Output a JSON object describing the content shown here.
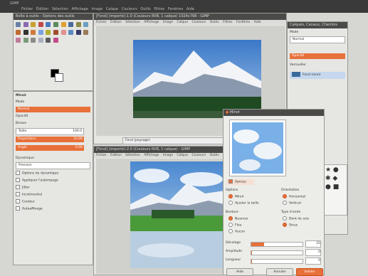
{
  "topbar": {
    "title": "GIMP",
    "menu": "Fichier Édition Sélection Affichage Image Calque Couleurs Outils Filtres Fenêtres Aide"
  },
  "toolbox": {
    "title": "Boîte à outils - Options des outils"
  },
  "options": {
    "title": "Miroir",
    "rows": [
      "Mode",
      "Normal",
      "Opacité",
      "Brosse",
      "Taille",
      "Proportions",
      "Angle",
      "Dynamique",
      "Pression"
    ],
    "values": [
      "100.0",
      "10.00",
      "0.00",
      "0.00"
    ],
    "checks": [
      "Options de dynamique",
      "Appliquer l'estompage",
      "Jitter",
      "Incrémentiel",
      "Contour",
      "Autoaffinage"
    ]
  },
  "img1": {
    "title": "[Fond] (importé)-1.0 (Couleurs RVB, 1 calque) 1024x768 - GIMP",
    "menu": "Fichier Édition Sélection Affichage Image Calque Couleurs Outils Filtres Fenêtres Aide",
    "status": "Fond (paysage)"
  },
  "img2": {
    "title": "[Fond] (importé)-2.0 (Couleurs RVB, 1 calque) - GIMP",
    "menu": "Fichier Édition Sélection Affichage Image Calque Couleurs Outils Filtres Fenêtres Aide"
  },
  "layers": {
    "title": "Calques, Canaux, Chemins",
    "mode": "Mode",
    "mode_val": "Normal",
    "opacity": "Opacité",
    "lock": "Verrouiller",
    "layer_name": "Fond miroir"
  },
  "dialog": {
    "title": "Miroir",
    "preview_label": "Aperçu",
    "options_title": "Options",
    "options": [
      "Miroir",
      "Ajuster la taille"
    ],
    "orientation_title": "Orientation",
    "orientation": [
      "Horizontal",
      "Vertical"
    ],
    "border_title": "Bordure",
    "border": [
      "Nuancer",
      "Flou",
      "Aucun"
    ],
    "wave_title": "Type d'onde",
    "wave": [
      "Dent de scie",
      "Sinus"
    ],
    "sliders": [
      {
        "label": "Décalage",
        "value": "25"
      },
      {
        "label": "Amplitude",
        "value": "0"
      },
      {
        "label": "Longueur",
        "value": "0"
      }
    ],
    "buttons": [
      "Aide",
      "Annuler",
      "Valider"
    ]
  }
}
